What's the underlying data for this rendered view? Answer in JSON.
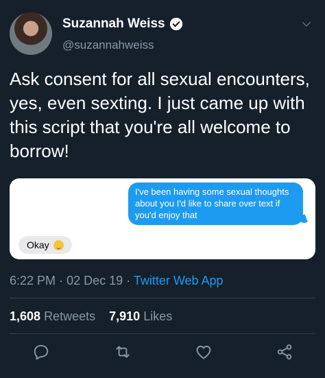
{
  "user": {
    "name": "Suzannah Weiss",
    "handle": "@suzannahweiss",
    "verified": true
  },
  "tweet": {
    "text": "Ask consent for all sexual encounters, yes, even sexting. I just came up with this script that you're all welcome to borrow!",
    "image": {
      "outgoing_message": "I've been having some sexual thoughts about you I'd like to share over text if you'd enjoy that",
      "incoming_message": "Okay",
      "incoming_emoji": "relieved-face-emoji"
    },
    "time": "6:22 PM",
    "date": "02 Dec 19",
    "source": "Twitter Web App",
    "separator": "·"
  },
  "stats": {
    "retweets_count": "1,608",
    "retweets_label": "Retweets",
    "likes_count": "7,910",
    "likes_label": "Likes"
  },
  "icons": {
    "reply": "comment-icon",
    "retweet": "retweet-icon",
    "like": "heart-icon",
    "share": "share-icon",
    "menu": "chevron-down-icon"
  },
  "colors": {
    "background": "#15202b",
    "accent": "#1d9bf0",
    "muted": "#8899a6",
    "divider": "#38444d"
  }
}
